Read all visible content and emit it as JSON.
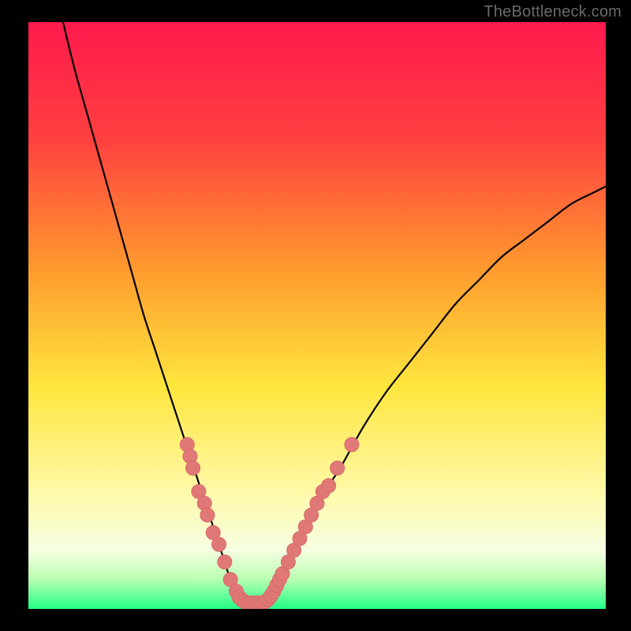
{
  "watermark": "TheBottleneck.com",
  "colors": {
    "frame": "#000000",
    "gradient_stops": [
      {
        "offset": 0.0,
        "color": "#ff1a4d"
      },
      {
        "offset": 0.2,
        "color": "#ff4040"
      },
      {
        "offset": 0.42,
        "color": "#ff9a2e"
      },
      {
        "offset": 0.62,
        "color": "#ffe63d"
      },
      {
        "offset": 0.8,
        "color": "#fff9a8"
      },
      {
        "offset": 0.9,
        "color": "#f6ffe2"
      },
      {
        "offset": 0.95,
        "color": "#b8ffb1"
      },
      {
        "offset": 1.0,
        "color": "#22ff88"
      }
    ],
    "curve": "#000000",
    "marker_fill": "#e07878",
    "marker_stroke": "#d96a6a"
  },
  "chart_data": {
    "type": "line",
    "title": "",
    "xlabel": "",
    "ylabel": "",
    "xlim": [
      0,
      100
    ],
    "ylim": [
      0,
      100
    ],
    "series": [
      {
        "name": "bottleneck-curve",
        "x": [
          6,
          8,
          10,
          12,
          14,
          16,
          18,
          20,
          22,
          24,
          25,
          26,
          27,
          28,
          29,
          30,
          31,
          32,
          33,
          34,
          35,
          36,
          37,
          38,
          39,
          40,
          41,
          42,
          43,
          44,
          45,
          46,
          48,
          50,
          52,
          54,
          58,
          62,
          66,
          70,
          74,
          78,
          82,
          86,
          90,
          94,
          98,
          100
        ],
        "y": [
          100,
          92,
          85,
          78,
          71,
          64,
          57,
          50,
          44,
          38,
          35,
          32,
          29,
          26,
          23,
          20,
          17,
          14,
          11,
          8,
          5,
          3,
          2,
          1,
          1,
          1,
          1,
          2,
          3,
          5,
          7,
          9,
          13,
          17,
          21,
          24,
          31,
          37,
          42,
          47,
          52,
          56,
          60,
          63,
          66,
          69,
          71,
          72
        ]
      }
    ],
    "markers": {
      "name": "highlighted-points",
      "points": [
        {
          "x": 27.5,
          "y": 28
        },
        {
          "x": 28.0,
          "y": 26
        },
        {
          "x": 28.5,
          "y": 24
        },
        {
          "x": 29.5,
          "y": 20
        },
        {
          "x": 30.5,
          "y": 18
        },
        {
          "x": 31.0,
          "y": 16
        },
        {
          "x": 32.0,
          "y": 13
        },
        {
          "x": 33.0,
          "y": 11
        },
        {
          "x": 34.0,
          "y": 8
        },
        {
          "x": 35.0,
          "y": 5
        },
        {
          "x": 36.0,
          "y": 3
        },
        {
          "x": 36.5,
          "y": 2
        },
        {
          "x": 37.0,
          "y": 1.5
        },
        {
          "x": 37.5,
          "y": 1.2
        },
        {
          "x": 38.0,
          "y": 1
        },
        {
          "x": 38.5,
          "y": 1
        },
        {
          "x": 39.0,
          "y": 1
        },
        {
          "x": 39.5,
          "y": 1
        },
        {
          "x": 40.0,
          "y": 1
        },
        {
          "x": 40.5,
          "y": 1
        },
        {
          "x": 41.0,
          "y": 1.2
        },
        {
          "x": 41.5,
          "y": 1.6
        },
        {
          "x": 42.0,
          "y": 2.2
        },
        {
          "x": 42.5,
          "y": 3
        },
        {
          "x": 43.0,
          "y": 4
        },
        {
          "x": 43.5,
          "y": 5
        },
        {
          "x": 44.0,
          "y": 6
        },
        {
          "x": 45.0,
          "y": 8
        },
        {
          "x": 46.0,
          "y": 10
        },
        {
          "x": 47.0,
          "y": 12
        },
        {
          "x": 48.0,
          "y": 14
        },
        {
          "x": 49.0,
          "y": 16
        },
        {
          "x": 50.0,
          "y": 18
        },
        {
          "x": 51.0,
          "y": 20
        },
        {
          "x": 52.0,
          "y": 21
        },
        {
          "x": 53.5,
          "y": 24
        },
        {
          "x": 56.0,
          "y": 28
        }
      ]
    }
  }
}
